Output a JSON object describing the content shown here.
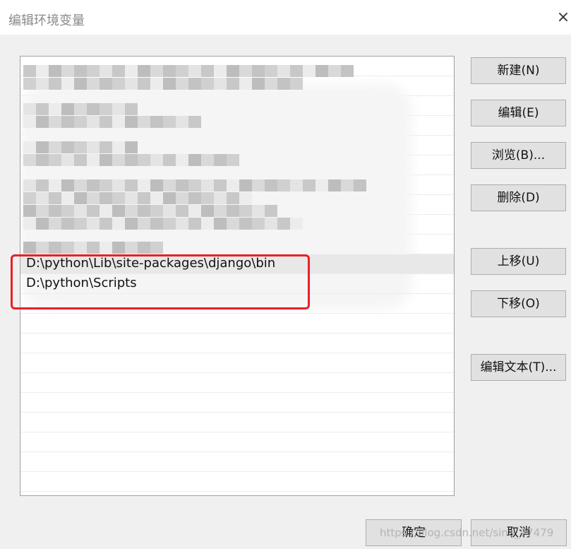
{
  "window": {
    "title": "编辑环境变量",
    "close_glyph": "×"
  },
  "path_list": {
    "entries": [
      "D:\\python\\Lib\\site-packages\\django\\bin",
      "D:\\python\\Scripts"
    ],
    "selected_index": 0
  },
  "buttons": {
    "new": "新建(N)",
    "edit": "编辑(E)",
    "browse": "浏览(B)...",
    "delete": "删除(D)",
    "move_up": "上移(U)",
    "move_down": "下移(O)",
    "edit_text": "编辑文本(T)...",
    "ok": "确定",
    "cancel": "取消"
  },
  "watermark": "https://blog.csdn.net/sina_77479",
  "colors": {
    "highlight_border": "#e8202a",
    "selected_row": "#e8e8e8",
    "button_face": "#e1e1e1"
  }
}
